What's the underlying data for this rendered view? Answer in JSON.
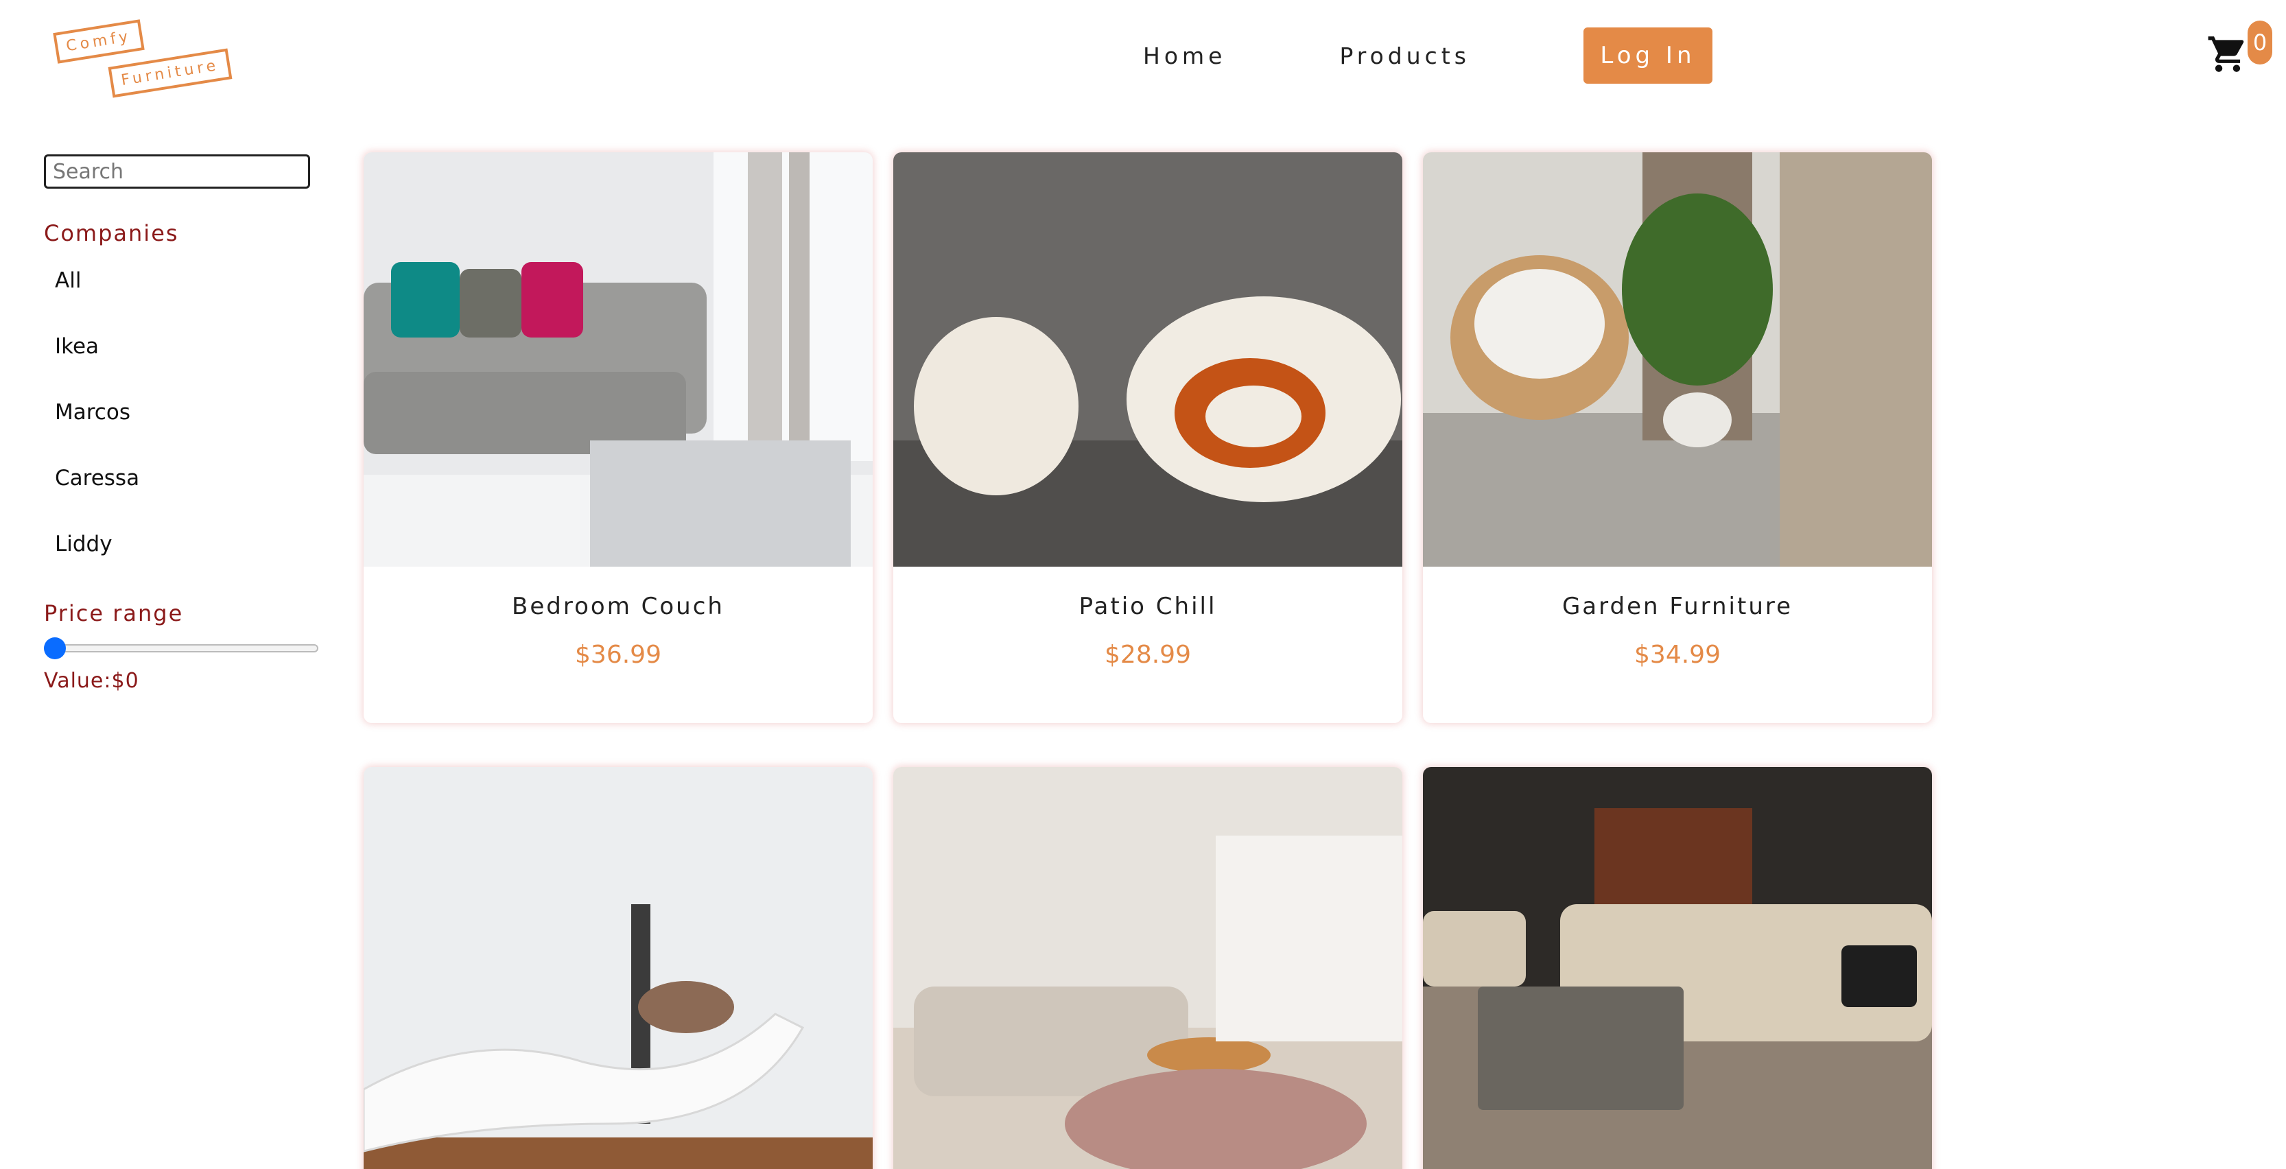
{
  "brand": {
    "line1": "Comfy",
    "line2": "Furniture"
  },
  "nav": {
    "home": "Home",
    "products": "Products",
    "login": "Log In"
  },
  "cart": {
    "count": "0",
    "icon": "shopping-cart-icon"
  },
  "sidebar": {
    "search_placeholder": "Search",
    "companies_title": "Companies",
    "companies": [
      "All",
      "Ikea",
      "Marcos",
      "Caressa",
      "Liddy"
    ],
    "price_title": "Price range",
    "value_label": "Value:$0",
    "price_value": 0
  },
  "products": [
    {
      "name": "Bedroom Couch",
      "price": "$36.99"
    },
    {
      "name": "Patio Chill",
      "price": "$28.99"
    },
    {
      "name": "Garden Furniture",
      "price": "$34.99"
    },
    {
      "name": "",
      "price": ""
    },
    {
      "name": "",
      "price": ""
    },
    {
      "name": "",
      "price": ""
    }
  ],
  "colors": {
    "accent": "#e48a47",
    "heading": "#8b1a1a",
    "slider": "#0a6cff"
  }
}
